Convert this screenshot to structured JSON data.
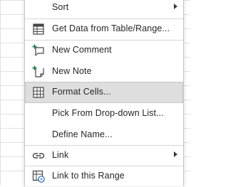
{
  "context_menu": {
    "items": [
      {
        "label": "Sort",
        "icon": "",
        "submenu": true
      },
      {
        "label": "Get Data from Table/Range...",
        "icon": "table-icon",
        "submenu": false
      },
      {
        "label": "New Comment",
        "icon": "new-comment-icon",
        "submenu": false
      },
      {
        "label": "New Note",
        "icon": "new-note-icon",
        "submenu": false
      },
      {
        "label": "Format Cells...",
        "icon": "format-cells-icon",
        "submenu": false,
        "highlighted": true
      },
      {
        "label": "Pick From Drop-down List...",
        "icon": "",
        "submenu": false
      },
      {
        "label": "Define Name...",
        "icon": "",
        "submenu": false
      },
      {
        "label": "Link",
        "icon": "link-icon",
        "submenu": true
      },
      {
        "label": "Link to this Range",
        "icon": "link-to-range-icon",
        "submenu": false
      }
    ]
  },
  "colors": {
    "highlight": "#dedede",
    "icon_accent": "#107c41",
    "text": "#262626"
  }
}
